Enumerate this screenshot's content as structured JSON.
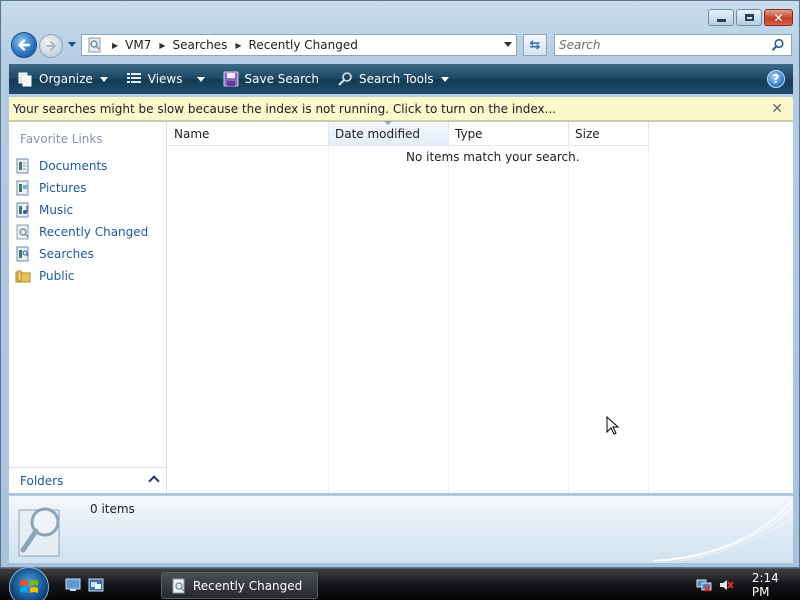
{
  "window": {
    "minimize_label": "Minimize",
    "maximize_label": "Maximize",
    "close_label": "Close"
  },
  "address_bar": {
    "crumbs": [
      "VM7",
      "Searches",
      "Recently Changed"
    ]
  },
  "search": {
    "placeholder": "Search"
  },
  "toolbar": {
    "organize": "Organize",
    "views": "Views",
    "save_search": "Save Search",
    "search_tools": "Search Tools"
  },
  "infobar": {
    "message": "Your searches might be slow because the index is not running.  Click to turn on the index..."
  },
  "nav_pane": {
    "title": "Favorite Links",
    "items": [
      {
        "label": "Documents",
        "icon": "documents-icon"
      },
      {
        "label": "Pictures",
        "icon": "pictures-icon"
      },
      {
        "label": "Music",
        "icon": "music-icon"
      },
      {
        "label": "Recently Changed",
        "icon": "recently-changed-icon"
      },
      {
        "label": "Searches",
        "icon": "searches-icon"
      },
      {
        "label": "Public",
        "icon": "public-folder-icon"
      }
    ],
    "folders_label": "Folders"
  },
  "columns": [
    "Name",
    "Date modified",
    "Type",
    "Size"
  ],
  "file_list": {
    "empty_message": "No items match your search."
  },
  "details": {
    "item_count": "0 items"
  },
  "taskbar": {
    "task_label": "Recently Changed",
    "clock": "2:14 PM"
  },
  "colors": {
    "toolbar_bg": "#1b4562",
    "infobar_bg": "#fdf7cc",
    "link_blue": "#1e5aa0"
  }
}
